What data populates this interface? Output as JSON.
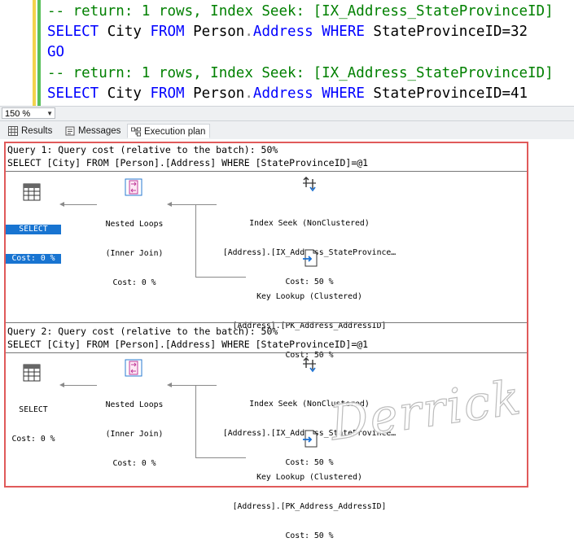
{
  "editor": {
    "lines": [
      {
        "type": "comment",
        "text": "-- return: 1 rows, Index Seek: [IX_Address_StateProvinceID]"
      },
      {
        "type": "select",
        "kw1": "SELECT",
        "col": " City ",
        "kw2": "FROM",
        "obj1": " Person",
        "dot": ".",
        "obj2": "Address",
        "kw3": " WHERE",
        "rest": " StateProvinceID=32"
      },
      {
        "type": "go",
        "text": "GO"
      },
      {
        "type": "comment",
        "text": "-- return: 1 rows, Index Seek: [IX_Address_StateProvinceID]"
      },
      {
        "type": "select",
        "kw1": "SELECT",
        "col": " City ",
        "kw2": "FROM",
        "obj1": " Person",
        "dot": ".",
        "obj2": "Address",
        "kw3": " WHERE",
        "rest": " StateProvinceID=41"
      }
    ]
  },
  "zoom": {
    "value": "150 %"
  },
  "tabs": [
    {
      "label": "Results",
      "icon": "grid-icon"
    },
    {
      "label": "Messages",
      "icon": "messages-icon"
    },
    {
      "label": "Execution plan",
      "icon": "execution-plan-icon"
    }
  ],
  "queries": [
    {
      "header": "Query 1: Query cost (relative to the batch): 50%",
      "sql": "SELECT [City] FROM [Person].[Address] WHERE [StateProvinceID]=@1",
      "select": {
        "label": "SELECT",
        "cost": "Cost: 0 %",
        "selected": true
      },
      "nested": {
        "l1": "Nested Loops",
        "l2": "(Inner Join)",
        "cost": "Cost: 0 %"
      },
      "seek": {
        "l1": "Index Seek (NonClustered)",
        "l2": "[Address].[IX_Address_StateProvince…",
        "cost": "Cost: 50 %"
      },
      "lookup": {
        "l1": "Key Lookup (Clustered)",
        "l2": "[Address].[PK_Address_AddressID]",
        "cost": "Cost: 50 %"
      }
    },
    {
      "header": "Query 2: Query cost (relative to the batch): 50%",
      "sql": "SELECT [City] FROM [Person].[Address] WHERE [StateProvinceID]=@1",
      "select": {
        "label": "SELECT",
        "cost": "Cost: 0 %",
        "selected": false
      },
      "nested": {
        "l1": "Nested Loops",
        "l2": "(Inner Join)",
        "cost": "Cost: 0 %"
      },
      "seek": {
        "l1": "Index Seek (NonClustered)",
        "l2": "[Address].[IX_Address_StateProvince…",
        "cost": "Cost: 50 %"
      },
      "lookup": {
        "l1": "Key Lookup (Clustered)",
        "l2": "[Address].[PK_Address_AddressID]",
        "cost": "Cost: 50 %"
      }
    }
  ],
  "watermark": "Derrick",
  "colors": {
    "keyword": "#0000ff",
    "comment": "#008000",
    "highlight": "#e05a5a",
    "selected": "#1874d1"
  }
}
